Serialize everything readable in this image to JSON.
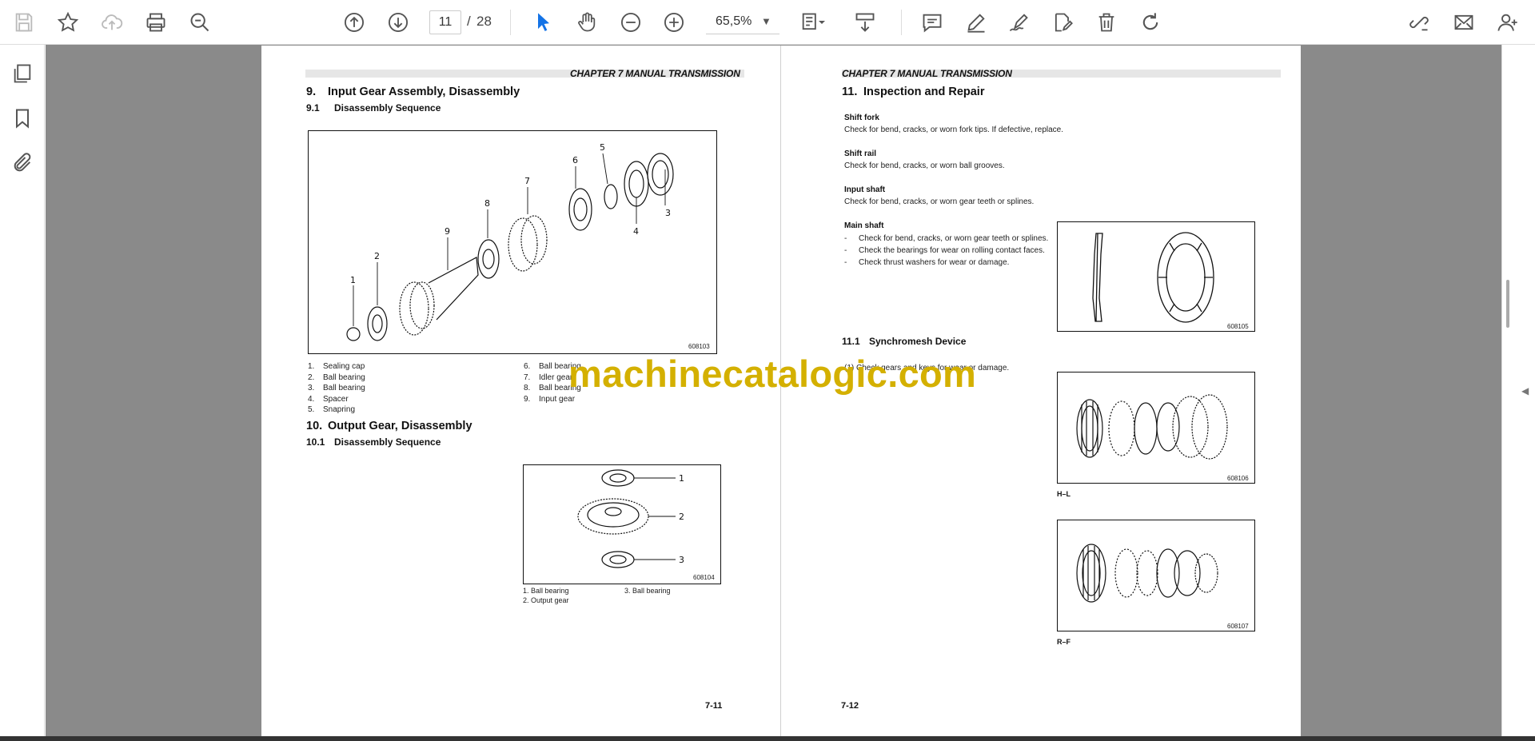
{
  "toolbar": {
    "current_page": "11",
    "page_separator": "/",
    "total_pages": "28",
    "zoom": "65,5%"
  },
  "icons": {
    "save": "floppy-disk-icon",
    "bookmark": "star-icon",
    "upload": "cloud-upload-icon",
    "print": "printer-icon",
    "find": "zoom-search-icon",
    "prev_page": "arrow-up-circle-icon",
    "next_page": "arrow-down-circle-icon",
    "select": "arrow-cursor-icon",
    "hand": "hand-icon",
    "zoom_out": "minus-circle-icon",
    "zoom_in": "plus-circle-icon"
  },
  "left_page": {
    "header": "CHAPTER 7 MANUAL TRANSMISSION",
    "section9_num": "9.",
    "section9_title": "Input Gear Assembly, Disassembly",
    "section91_num": "9.1",
    "section91_title": "Disassembly Sequence",
    "fig1_code": "608103",
    "fig1_labels": [
      "1",
      "2",
      "3",
      "4",
      "5",
      "6",
      "7",
      "8",
      "9"
    ],
    "parts_col1": [
      "1.",
      "2.",
      "3.",
      "4.",
      "5."
    ],
    "parts_col1_names": [
      "Sealing cap",
      "Ball bearing",
      "Ball bearing",
      "Spacer",
      "Snapring"
    ],
    "parts_col2": [
      "6.",
      "7.",
      "8.",
      "9."
    ],
    "parts_col2_names": [
      "Ball bearing",
      "Idler gear",
      "Ball bearing",
      "Input gear"
    ],
    "section10_num": "10.",
    "section10_title": "Output Gear, Disassembly",
    "section101_num": "10.1",
    "section101_title": "Disassembly Sequence",
    "fig2_code": "608104",
    "fig2_labels": [
      "1",
      "2",
      "3"
    ],
    "fig2_legend_1": "1. Ball bearing",
    "fig2_legend_2": "2. Output gear",
    "fig2_legend_3": "3. Ball bearing",
    "page_number": "7-11"
  },
  "right_page": {
    "header": "CHAPTER 7 MANUAL TRANSMISSION",
    "section11_num": "11.",
    "section11_title": "Inspection and Repair",
    "shift_fork_title": "Shift fork",
    "shift_fork_text": "Check for bend, cracks, or worn fork tips. If defective, replace.",
    "shift_rail_title": "Shift rail",
    "shift_rail_text": "Check for bend, cracks, or worn ball grooves.",
    "input_shaft_title": "Input shaft",
    "input_shaft_text": "Check for bend, cracks, or worn gear teeth or splines.",
    "main_shaft_title": "Main shaft",
    "main_shaft_items": [
      "Check for bend, cracks, or worn gear teeth or splines.",
      "Check the bearings for wear on rolling contact faces.",
      "Check thrust washers for wear or damage."
    ],
    "bullet": "-",
    "section111_num": "11.1",
    "section111_title": "Synchromesh Device",
    "synchro_text": "(1)   Check gears and keys for wear or damage.",
    "fig3_code": "608105",
    "fig4_code": "608106",
    "fig4_caption": "H–L",
    "fig5_code": "608107",
    "fig5_caption": "R–F",
    "page_number": "7-12"
  },
  "watermark": "machinecatalogic.com"
}
